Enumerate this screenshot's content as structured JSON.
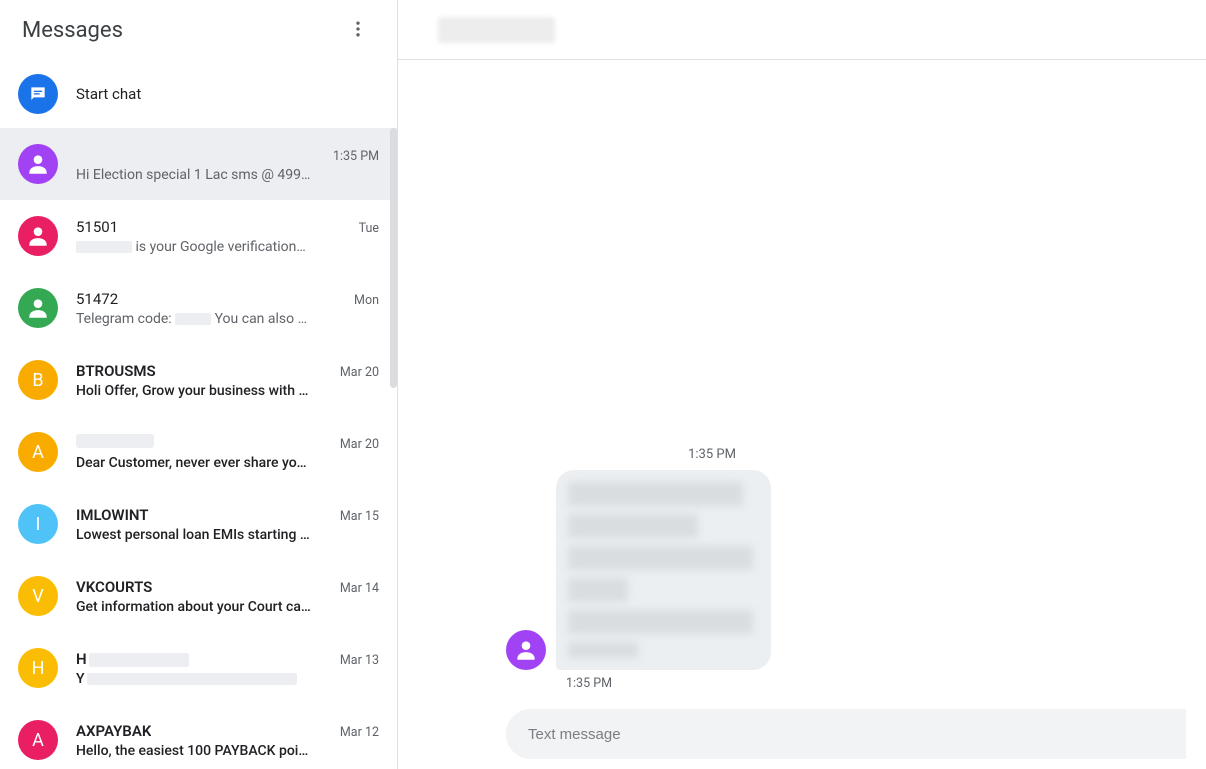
{
  "sidebar": {
    "title": "Messages",
    "start_chat_label": "Start chat"
  },
  "conversations": [
    {
      "id": "c0",
      "name": "",
      "name_redacted": true,
      "time": "1:35 PM",
      "preview": "Hi Election special 1 Lac sms @ 499…",
      "unread": false,
      "avatar": {
        "type": "person",
        "bg": "#a142f4"
      },
      "active": true
    },
    {
      "id": "c1",
      "name": "51501",
      "time": "Tue",
      "preview_pre": "",
      "preview_pre_redacted": true,
      "preview_post": " is your Google verification…",
      "unread": false,
      "avatar": {
        "type": "person",
        "bg": "#e91e63"
      }
    },
    {
      "id": "c2",
      "name": "51472",
      "time": "Mon",
      "preview_pre": "Telegram code: ",
      "mid_redacted": true,
      "preview_post": " You can also …",
      "unread": false,
      "avatar": {
        "type": "person",
        "bg": "#34a853"
      }
    },
    {
      "id": "c3",
      "name": "BTROUSMS",
      "time": "Mar 20",
      "preview": "Holi Offer, Grow your business with …",
      "unread": true,
      "avatar": {
        "type": "letter",
        "letter": "B",
        "bg": "#f9ab00"
      }
    },
    {
      "id": "c4",
      "name": "",
      "name_redacted": true,
      "time": "Mar 20",
      "preview": "Dear Customer, never ever share yo…",
      "unread": true,
      "avatar": {
        "type": "letter",
        "letter": "A",
        "bg": "#f9ab00"
      }
    },
    {
      "id": "c5",
      "name": "IMLOWINT",
      "time": "Mar 15",
      "preview": "Lowest personal loan EMIs starting …",
      "unread": true,
      "avatar": {
        "type": "letter",
        "letter": "I",
        "bg": "#4fc3f7"
      }
    },
    {
      "id": "c6",
      "name": "VKCOURTS",
      "time": "Mar 14",
      "preview": "Get information about your Court ca…",
      "unread": true,
      "avatar": {
        "type": "letter",
        "letter": "V",
        "bg": "#fbbc04"
      }
    },
    {
      "id": "c7",
      "name": "H",
      "name_redacted": true,
      "time": "Mar 13",
      "preview": "Y",
      "preview_redacted": true,
      "unread": true,
      "avatar": {
        "type": "letter",
        "letter": "H",
        "bg": "#fbbc04"
      }
    },
    {
      "id": "c8",
      "name": "AXPAYBAK",
      "time": "Mar 12",
      "preview": "Hello, the easiest 100 PAYBACK poi…",
      "unread": true,
      "avatar": {
        "type": "letter",
        "letter": "A",
        "bg": "#e91e63"
      }
    }
  ],
  "chat": {
    "header_name": "",
    "timestamp": "1:35 PM",
    "message_time": "1:35 PM"
  },
  "composer": {
    "placeholder": "Text message"
  }
}
